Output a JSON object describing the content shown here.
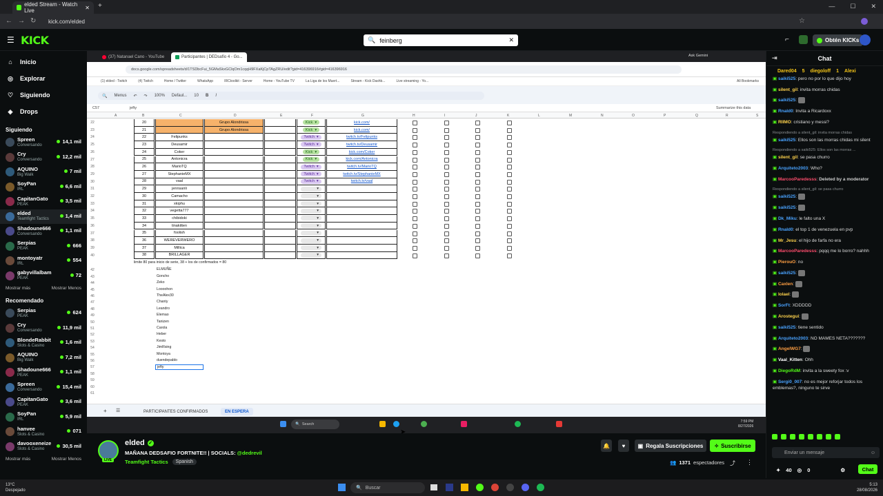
{
  "browser": {
    "tab_title": "elded Stream - Watch Live",
    "url": "kick.com/elded"
  },
  "header": {
    "logo": "KICK",
    "search_value": "feinberg",
    "get_kicks": "Obtén KICKs"
  },
  "sidebar": {
    "nav": [
      {
        "label": "Inicio",
        "icon": "home-icon"
      },
      {
        "label": "Explorar",
        "icon": "compass-icon"
      },
      {
        "label": "Siguiendo",
        "icon": "heart-icon"
      },
      {
        "label": "Drops",
        "icon": "drop-icon"
      }
    ],
    "following_title": "Siguiendo",
    "following": [
      {
        "name": "Spreen",
        "game": "Conversando",
        "viewers": "14,1 mil"
      },
      {
        "name": "Cry",
        "game": "Conversando",
        "viewers": "12,2 mil"
      },
      {
        "name": "AQUINO",
        "game": "Big Walk",
        "viewers": "7 mil"
      },
      {
        "name": "SoyPan",
        "game": "IRL",
        "viewers": "6,6 mil"
      },
      {
        "name": "CapitanGato",
        "game": "PEAK",
        "viewers": "3,5 mil"
      },
      {
        "name": "elded",
        "game": "Teamfight Tactics",
        "viewers": "1,4 mil"
      },
      {
        "name": "Shadoune666",
        "game": "Conversando",
        "viewers": "1,1 mil"
      },
      {
        "name": "Serpias",
        "game": "PEAK",
        "viewers": "666"
      },
      {
        "name": "montoyatr",
        "game": "IRL",
        "viewers": "554"
      },
      {
        "name": "gabyvillalbam",
        "game": "PEAK",
        "viewers": "72"
      }
    ],
    "show_more": "Mostrar más",
    "show_less": "Mostrar Menos",
    "recommended_title": "Recomendado",
    "recommended": [
      {
        "name": "Serpias",
        "game": "PEAK",
        "viewers": "624"
      },
      {
        "name": "Cry",
        "game": "Conversando",
        "viewers": "11,9 mil"
      },
      {
        "name": "BlondeRabbit",
        "game": "Slots & Casino",
        "viewers": "1,6 mil"
      },
      {
        "name": "AQUINO",
        "game": "Big Walk",
        "viewers": "7,2 mil"
      },
      {
        "name": "Shadoune666",
        "game": "PEAK",
        "viewers": "1,1 mil"
      },
      {
        "name": "Spreen",
        "game": "Conversando",
        "viewers": "15,4 mil"
      },
      {
        "name": "CapitanGato",
        "game": "PEAK",
        "viewers": "3,6 mil"
      },
      {
        "name": "SoyPan",
        "game": "IRL",
        "viewers": "5,9 mil"
      },
      {
        "name": "hanvee",
        "game": "Slots & Casino",
        "viewers": "071"
      },
      {
        "name": "davooxeneize",
        "game": "Slots & Casino",
        "viewers": "30,5 mil"
      }
    ]
  },
  "inner_browser": {
    "tabs": [
      "(37) Natanael Cano - YouTube",
      "Participantes | DEDsafío 4 - Go..."
    ],
    "url": "docs.google.com/spreadsheets/d/1TSDbcFui_5GMaSkxGClqOm1cqqH9FXaKjCpTAgZRU/edit?gid=416396916#gid=416396916",
    "bookmarks": [
      "(1) elded - Twitch",
      "(4) Twitch",
      "Home / Twitter",
      "WhatsApp",
      "IRCtoolkit - Server",
      "Home - YouTube TV",
      "La Liga de los Muert...",
      "Stream - Kick Dashb...",
      "Live streaming - Yo..."
    ],
    "all_bookmarks": "All Bookmarks",
    "ask_gemini": "Ask Gemini"
  },
  "sheet": {
    "toolbar": {
      "menus": "Menus",
      "zoom": "100%",
      "font": "Defaul...",
      "size": "10"
    },
    "cell_ref": "C57",
    "formula_value": "jefty",
    "summarize": "Summarize this data",
    "columns": [
      "A",
      "B",
      "C",
      "D",
      "E",
      "F",
      "G",
      "H",
      "I",
      "J",
      "K",
      "L",
      "M",
      "N",
      "O",
      "P",
      "Q",
      "R",
      "S"
    ],
    "rows": [
      {
        "n": "22",
        "b": "20",
        "c": "",
        "d": "Grupo Alondrissa",
        "f": "Kick",
        "g": "kick.com/",
        "orange": true
      },
      {
        "n": "23",
        "b": "21",
        "c": "",
        "d": "Grupo Alondrissa",
        "f": "Kick",
        "g": "kick.com/",
        "orange": true
      },
      {
        "n": "24",
        "b": "22",
        "c": "Felipunks",
        "d": "",
        "f": "Twitch",
        "g": "twitch.tv/Felipunks"
      },
      {
        "n": "25",
        "b": "23",
        "c": "Deusamir",
        "d": "",
        "f": "Twitch",
        "g": "twitch.tv/Deusamir"
      },
      {
        "n": "26",
        "b": "24",
        "c": "Coker",
        "d": "",
        "f": "Kick",
        "g": "kick.com/Coker"
      },
      {
        "n": "27",
        "b": "25",
        "c": "Antonicra",
        "d": "",
        "f": "Kick",
        "g": "kick.com/Antonicra"
      },
      {
        "n": "28",
        "b": "26",
        "c": "MarioTQ",
        "d": "",
        "f": "Twitch",
        "g": "twitch.tv/MarioTQ"
      },
      {
        "n": "29",
        "b": "27",
        "c": "StephanieMX",
        "d": "",
        "f": "Twitch",
        "g": "twitch.tv/StephanieMX"
      },
      {
        "n": "30",
        "b": "28",
        "c": "vaal",
        "d": "",
        "f": "Twitch",
        "g": "twitch.tv/vaal"
      },
      {
        "n": "31",
        "b": "29",
        "c": "jennsanli",
        "d": "",
        "f": "",
        "g": ""
      },
      {
        "n": "32",
        "b": "30",
        "c": "Camacho",
        "d": "",
        "f": "",
        "g": ""
      },
      {
        "n": "33",
        "b": "31",
        "c": "xkiphu",
        "d": "",
        "f": "",
        "g": ""
      },
      {
        "n": "34",
        "b": "32",
        "c": "vegetta777",
        "d": "",
        "f": "",
        "g": ""
      },
      {
        "n": "35",
        "b": "33",
        "c": "chibidoki",
        "d": "",
        "f": "",
        "g": ""
      },
      {
        "n": "36",
        "b": "34",
        "c": "tinakitten",
        "d": "",
        "f": "",
        "g": ""
      },
      {
        "n": "37",
        "b": "35",
        "c": "foolish",
        "d": "",
        "f": "",
        "g": ""
      },
      {
        "n": "38",
        "b": "36",
        "c": "WEREVERWERO",
        "d": "",
        "f": "",
        "g": ""
      },
      {
        "n": "39",
        "b": "37",
        "c": "Millica",
        "d": "",
        "f": "",
        "g": ""
      },
      {
        "n": "40",
        "b": "38",
        "c": "BRILLAGER",
        "d": "",
        "f": "",
        "g": ""
      }
    ],
    "note": "limite 80 para inicio de serie, 38 + los de confirmados = 80",
    "list": [
      "ELMUÑE",
      "Goncho",
      "Zeko",
      "Loooohon",
      "TheAlex30",
      "Chanty",
      "Leandro",
      "Elemao",
      "Tanizen",
      "Carola",
      "Heber",
      "Kesto",
      "JimRsing",
      "Montoya",
      "duendepablo",
      "jefty"
    ],
    "list_rows": [
      "42",
      "43",
      "44",
      "45",
      "46",
      "47",
      "48",
      "49",
      "50",
      "51",
      "52",
      "53",
      "54",
      "55",
      "56",
      "57",
      "58",
      "59",
      "60",
      "61"
    ],
    "tabs": [
      "PARTICIPANTES CONFIRMADOS",
      "EN ESPERA"
    ],
    "taskbar_search": "Search",
    "time": "7:59 PM",
    "date": "8/27/2026"
  },
  "chat": {
    "title": "Chat",
    "top_gifters": [
      "Dared04",
      "5",
      "diegoloff",
      "1",
      "Alexi"
    ],
    "messages": [
      {
        "user": "saiki525",
        "color": "#4aa3ff",
        "text": "pero no por lo que dijo hoy"
      },
      {
        "user": "silent_gil",
        "color": "#ffd34d",
        "text": "invita morras chidas"
      },
      {
        "user": "saiki525",
        "color": "#4aa3ff",
        "text": ""
      },
      {
        "user": "Rnald0",
        "color": "#4aa3ff",
        "text": "Invita a Ricardoxx"
      },
      {
        "user": "RIIMO",
        "color": "#ffd34d",
        "text": "cristiano y messi?"
      },
      {
        "reply": "Respondiendo a silent_gil: invita morras chidas"
      },
      {
        "user": "saiki525",
        "color": "#4aa3ff",
        "text": "Ellos son las morras chidas mi silent"
      },
      {
        "reply": "Respondiendo a saiki525: Ellos son las morras ..."
      },
      {
        "user": "silent_gil",
        "color": "#ffd34d",
        "text": "se pasa churro"
      },
      {
        "user": "Arquiteto2003",
        "color": "#4aa3ff",
        "text": "Who?"
      },
      {
        "user": "MarcooParedesss",
        "color": "#ff4d6d",
        "text": "Deleted by a moderator"
      },
      {
        "reply": "Respondiendo a silent_gil: se pasa churro"
      },
      {
        "user": "saiki525",
        "color": "#4aa3ff",
        "text": ""
      },
      {
        "user": "saiki525",
        "color": "#4aa3ff",
        "text": ""
      },
      {
        "user": "Dk_Miku",
        "color": "#4aa3ff",
        "text": "le falto una X"
      },
      {
        "user": "Rnald0",
        "color": "#4aa3ff",
        "text": "el top 1 de venezuela en pvp"
      },
      {
        "user": "Mr_Jesu",
        "color": "#ffd34d",
        "text": "el hijo de farfa no era"
      },
      {
        "user": "MarcooParedesss",
        "color": "#ff4d6d",
        "text": "pqqq me lo borro? nahhh"
      },
      {
        "user": "PierouO",
        "color": "#ff9f43",
        "text": "no"
      },
      {
        "user": "saiki525",
        "color": "#4aa3ff",
        "text": ""
      },
      {
        "user": "Caxlen",
        "color": "#ff9f43",
        "text": ""
      },
      {
        "user": "lolael",
        "color": "#ffd34d",
        "text": ""
      },
      {
        "user": "SorFt",
        "color": "#4aa3ff",
        "text": "XDDDDD"
      },
      {
        "user": "Arostegui",
        "color": "#ffd34d",
        "text": ""
      },
      {
        "user": "saiki525",
        "color": "#4aa3ff",
        "text": "tiene sentido"
      },
      {
        "user": "Arquiteto2003",
        "color": "#4aa3ff",
        "text": "NO MAMES NETA???????"
      },
      {
        "user": "AngelWG7",
        "color": "#ff9f43",
        "text": ""
      },
      {
        "user": "Vaal_Kitten",
        "color": "#ffffff",
        "text": "Ohh"
      },
      {
        "user": "DiegoRdM",
        "color": "#53fc18",
        "text": "invita a la sweety fox :v"
      },
      {
        "user": "Sergi0_007",
        "color": "#4aa3ff",
        "text": "no es mejor reforjar todos los emblemas?, ninguno te sirve"
      }
    ],
    "input_placeholder": "Enviar un mensaje",
    "points": "40",
    "kicks": "0",
    "send_label": "Chat"
  },
  "streamer": {
    "name": "elded",
    "title": "MAÑANA DEDSAFIO FORTNITE!! | SOCIALS:",
    "handle": "@dedrevil",
    "category": "Teamfight Tactics",
    "language": "Spanish",
    "live_badge": "LIVE",
    "gift_subs": "Regala Suscripciones",
    "subscribe": "Suscribirse",
    "viewers": "1371",
    "viewers_label": "espectadores"
  },
  "os": {
    "weather_temp": "13°C",
    "weather_desc": "Despejado",
    "search": "Buscar",
    "time": "5:13",
    "date": "28/08/2026"
  }
}
